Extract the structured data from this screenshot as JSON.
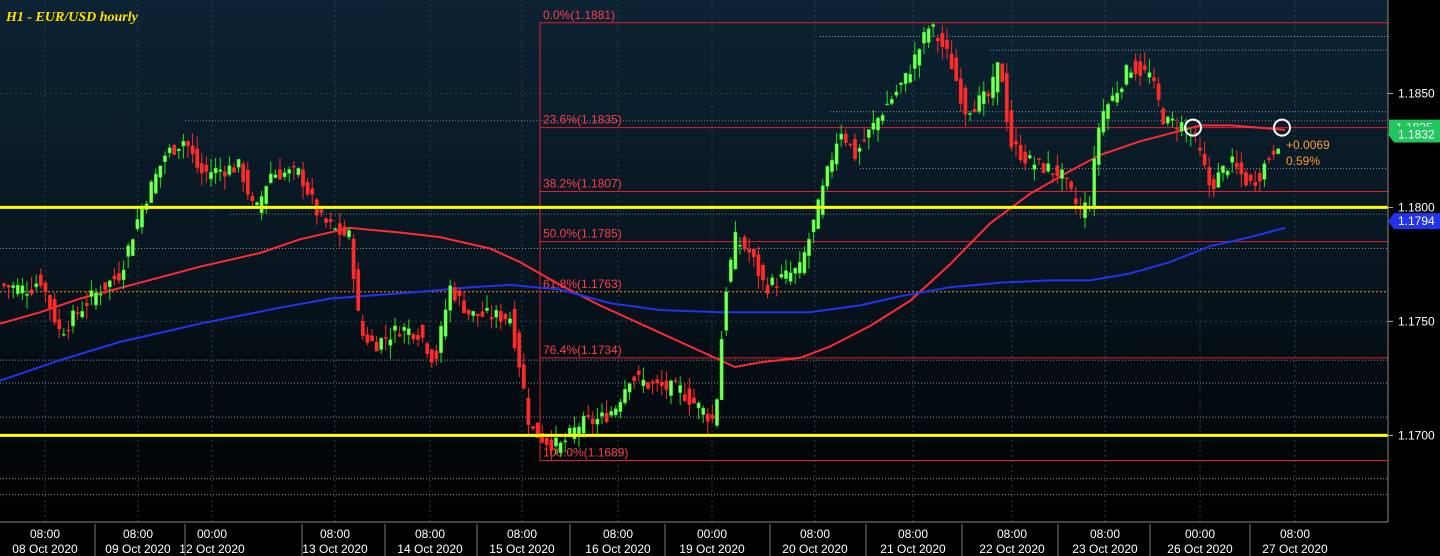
{
  "chart_data": {
    "type": "candlestick",
    "title": "H1 - EUR/USD hourly",
    "ylim": [
      1.1662,
      1.1891
    ],
    "y_ticks": [
      {
        "value": 1.185,
        "label": "1.1850"
      },
      {
        "value": 1.18,
        "label": "1.1800"
      },
      {
        "value": 1.175,
        "label": "1.1750"
      },
      {
        "value": 1.17,
        "label": "1.1700"
      }
    ],
    "x_ticks": [
      {
        "time": "08:00",
        "date": "08 Oct 2020"
      },
      {
        "time": "08:00",
        "date": "09 Oct 2020"
      },
      {
        "time": "00:00",
        "date": "12 Oct 2020"
      },
      {
        "time": "08:00",
        "date": "13 Oct 2020"
      },
      {
        "time": "08:00",
        "date": "14 Oct 2020"
      },
      {
        "time": "08:00",
        "date": "15 Oct 2020"
      },
      {
        "time": "08:00",
        "date": "16 Oct 2020"
      },
      {
        "time": "00:00",
        "date": "19 Oct 2020"
      },
      {
        "time": "08:00",
        "date": "20 Oct 2020"
      },
      {
        "time": "08:00",
        "date": "21 Oct 2020"
      },
      {
        "time": "08:00",
        "date": "22 Oct 2020"
      },
      {
        "time": "08:00",
        "date": "23 Oct 2020"
      },
      {
        "time": "00:00",
        "date": "26 Oct 2020"
      },
      {
        "time": "08:00",
        "date": "27 Oct 2020"
      }
    ],
    "fibonacci": [
      {
        "label": "0.0%(1.1881)",
        "value": 1.1881
      },
      {
        "label": "23.6%(1.1835)",
        "value": 1.1835
      },
      {
        "label": "38.2%(1.1807)",
        "value": 1.1807
      },
      {
        "label": "50.0%(1.1785)",
        "value": 1.1785
      },
      {
        "label": "61.8%(1.1763)",
        "value": 1.1763
      },
      {
        "label": "76.4%(1.1734)",
        "value": 1.1734
      },
      {
        "label": "100.0%(1.1689)",
        "value": 1.1689
      }
    ],
    "horizontal_levels": [
      {
        "value": 1.18,
        "color": "#ffff00"
      },
      {
        "value": 1.17,
        "color": "#ffff00"
      }
    ],
    "price_tags": [
      {
        "label": "1.1832",
        "value": 1.1832,
        "color": "#22c55e"
      },
      {
        "label": "1.1794",
        "value": 1.1794,
        "color": "#2233ee"
      }
    ],
    "partial_tag_label": "1.1835",
    "change_annotation": {
      "abs": "+0.0069",
      "pct": "0.59%"
    },
    "series": [
      {
        "name": "MA-red",
        "color": "#ff2a36",
        "points": [
          [
            0,
            1.1749
          ],
          [
            40,
            1.1754
          ],
          [
            80,
            1.176
          ],
          [
            140,
            1.1767
          ],
          [
            200,
            1.1774
          ],
          [
            260,
            1.178
          ],
          [
            300,
            1.1786
          ],
          [
            350,
            1.1791
          ],
          [
            400,
            1.1789
          ],
          [
            440,
            1.1787
          ],
          [
            490,
            1.1782
          ],
          [
            520,
            1.1776
          ],
          [
            560,
            1.1766
          ],
          [
            600,
            1.1757
          ],
          [
            650,
            1.1747
          ],
          [
            700,
            1.1737
          ],
          [
            735,
            1.173
          ],
          [
            760,
            1.1732
          ],
          [
            800,
            1.1734
          ],
          [
            830,
            1.1739
          ],
          [
            870,
            1.1748
          ],
          [
            910,
            1.1759
          ],
          [
            950,
            1.1775
          ],
          [
            990,
            1.1793
          ],
          [
            1030,
            1.1806
          ],
          [
            1070,
            1.1816
          ],
          [
            1100,
            1.1823
          ],
          [
            1140,
            1.1829
          ],
          [
            1175,
            1.1833
          ],
          [
            1200,
            1.1836
          ],
          [
            1230,
            1.1836
          ],
          [
            1260,
            1.1835
          ],
          [
            1285,
            1.1834
          ]
        ]
      },
      {
        "name": "MA-blue",
        "color": "#2233ee",
        "points": [
          [
            0,
            1.1724
          ],
          [
            60,
            1.1733
          ],
          [
            120,
            1.1741
          ],
          [
            200,
            1.1749
          ],
          [
            280,
            1.1756
          ],
          [
            330,
            1.176
          ],
          [
            360,
            1.1761
          ],
          [
            420,
            1.1763
          ],
          [
            470,
            1.1765
          ],
          [
            510,
            1.1766
          ],
          [
            560,
            1.1764
          ],
          [
            610,
            1.1758
          ],
          [
            660,
            1.1755
          ],
          [
            720,
            1.1754
          ],
          [
            810,
            1.1754
          ],
          [
            860,
            1.1757
          ],
          [
            900,
            1.1761
          ],
          [
            950,
            1.1765
          ],
          [
            1000,
            1.1767
          ],
          [
            1050,
            1.1768
          ],
          [
            1090,
            1.1768
          ],
          [
            1130,
            1.1771
          ],
          [
            1170,
            1.1776
          ],
          [
            1210,
            1.1783
          ],
          [
            1250,
            1.1787
          ],
          [
            1285,
            1.1791
          ]
        ]
      },
      {
        "name": "price-anchors",
        "color": "#22c55e",
        "points": [
          [
            0,
            1.1766
          ],
          [
            30,
            1.1764
          ],
          [
            40,
            1.1769
          ],
          [
            60,
            1.1745
          ],
          [
            90,
            1.176
          ],
          [
            120,
            1.1771
          ],
          [
            140,
            1.1798
          ],
          [
            165,
            1.1823
          ],
          [
            185,
            1.183
          ],
          [
            200,
            1.1815
          ],
          [
            240,
            1.1818
          ],
          [
            255,
            1.1797
          ],
          [
            270,
            1.1815
          ],
          [
            300,
            1.1815
          ],
          [
            320,
            1.1795
          ],
          [
            335,
            1.179
          ],
          [
            350,
            1.1787
          ],
          [
            360,
            1.1745
          ],
          [
            375,
            1.174
          ],
          [
            400,
            1.1747
          ],
          [
            420,
            1.1745
          ],
          [
            435,
            1.1732
          ],
          [
            450,
            1.1765
          ],
          [
            470,
            1.1753
          ],
          [
            510,
            1.1752
          ],
          [
            520,
            1.173
          ],
          [
            530,
            1.1703
          ],
          [
            545,
            1.1698
          ],
          [
            560,
            1.1695
          ],
          [
            580,
            1.1705
          ],
          [
            600,
            1.1707
          ],
          [
            615,
            1.1712
          ],
          [
            630,
            1.1726
          ],
          [
            650,
            1.1722
          ],
          [
            680,
            1.172
          ],
          [
            700,
            1.1712
          ],
          [
            715,
            1.1706
          ],
          [
            725,
            1.1762
          ],
          [
            735,
            1.1786
          ],
          [
            750,
            1.178
          ],
          [
            765,
            1.1765
          ],
          [
            800,
            1.1773
          ],
          [
            815,
            1.1795
          ],
          [
            840,
            1.1835
          ],
          [
            855,
            1.1823
          ],
          [
            885,
            1.1844
          ],
          [
            905,
            1.1856
          ],
          [
            930,
            1.188
          ],
          [
            950,
            1.1865
          ],
          [
            965,
            1.1843
          ],
          [
            990,
            1.1849
          ],
          [
            1000,
            1.1865
          ],
          [
            1010,
            1.1828
          ],
          [
            1030,
            1.182
          ],
          [
            1060,
            1.1815
          ],
          [
            1080,
            1.1798
          ],
          [
            1090,
            1.1803
          ],
          [
            1100,
            1.184
          ],
          [
            1115,
            1.185
          ],
          [
            1130,
            1.1862
          ],
          [
            1150,
            1.1858
          ],
          [
            1165,
            1.1837
          ],
          [
            1180,
            1.1837
          ],
          [
            1195,
            1.183
          ],
          [
            1210,
            1.1809
          ],
          [
            1230,
            1.182
          ],
          [
            1250,
            1.181
          ],
          [
            1260,
            1.1815
          ],
          [
            1270,
            1.1823
          ],
          [
            1282,
            1.1832
          ]
        ]
      }
    ],
    "circle_markers": [
      {
        "index": 1193,
        "value": 1.1835
      },
      {
        "index": 1282,
        "value": 1.1835
      }
    ],
    "grid": true
  }
}
